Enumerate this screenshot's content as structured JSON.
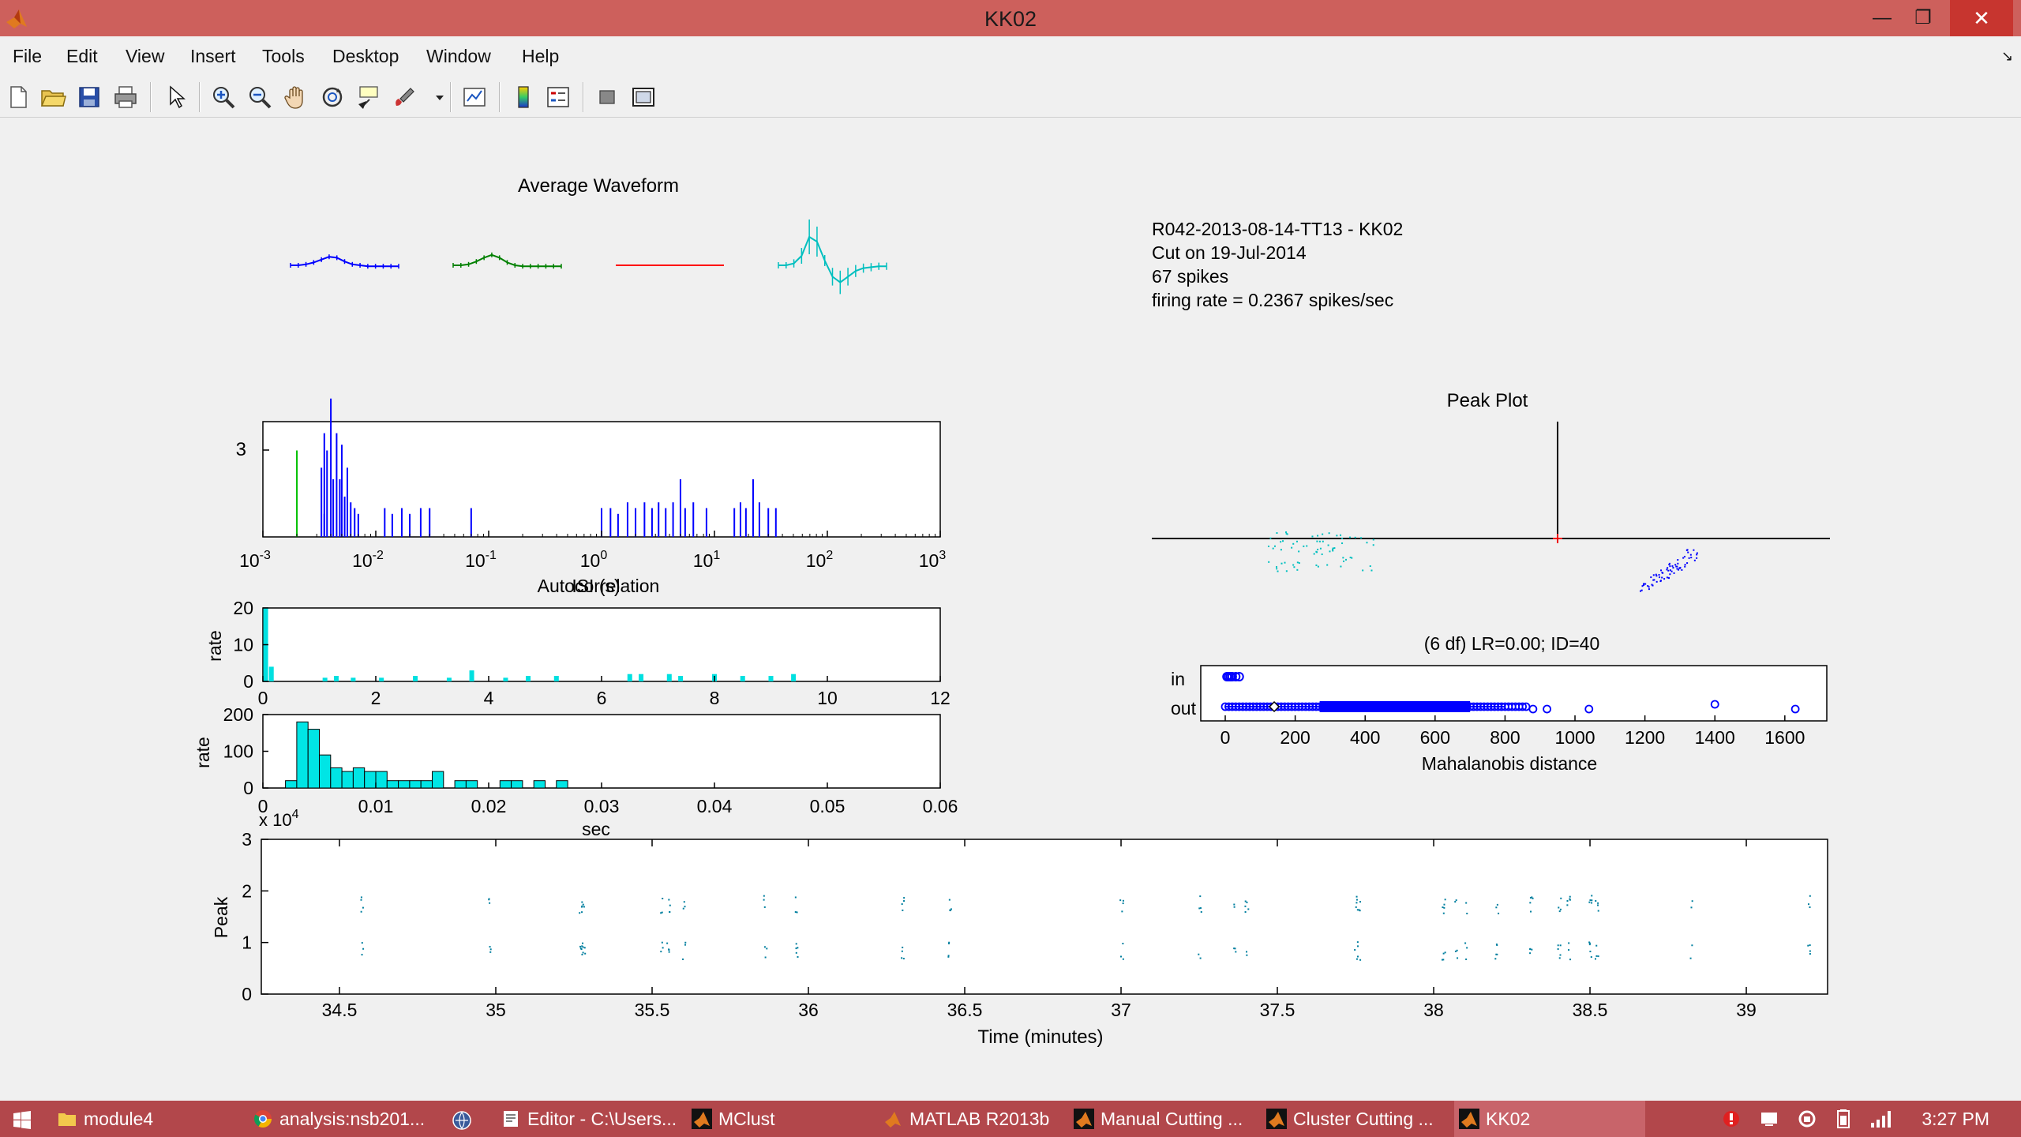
{
  "window": {
    "title": "KK02"
  },
  "menu": [
    "File",
    "Edit",
    "View",
    "Insert",
    "Tools",
    "Desktop",
    "Window",
    "Help"
  ],
  "toolbar_icons": [
    "new-figure-icon",
    "open-file-icon",
    "save-icon",
    "print-icon",
    "pointer-icon",
    "zoom-in-icon",
    "zoom-out-icon",
    "pan-icon",
    "rotate-3d-icon",
    "data-cursor-icon",
    "brush-icon",
    "dropdown-arrow-icon",
    "link-plot-icon",
    "colorbar-icon",
    "legend-icon",
    "hide-plot-tools-icon",
    "show-plot-tools-icon"
  ],
  "waveform": {
    "title": "Average Waveform",
    "colors": [
      "#0000ff",
      "#008000",
      "#ff0000",
      "#00bfbf"
    ]
  },
  "info": {
    "line1": "R042-2013-08-14-TT13 - KK02",
    "line2": "Cut on 19-Jul-2014",
    "line3": "67 spikes",
    "line4": "firing rate = 0.2367 spikes/sec"
  },
  "isi_hist": {
    "type": "bar",
    "xscale": "log",
    "xlim": [
      0.001,
      1000
    ],
    "xticks": [
      "10",
      "10",
      "10",
      "10",
      "10",
      "10",
      "10"
    ],
    "xtick_exp": [
      "-3",
      "-2",
      "-1",
      "0",
      "1",
      "2",
      "3"
    ],
    "ytick": "3",
    "xlabel": "ISI (s)",
    "marker_line_x": 0.002,
    "marker_color": "#00c000",
    "bar_color": "#0000ff",
    "values": [
      {
        "x": 0.0033,
        "h": 0.6
      },
      {
        "x": 0.0035,
        "h": 0.9
      },
      {
        "x": 0.0037,
        "h": 0.75
      },
      {
        "x": 0.004,
        "h": 1.2
      },
      {
        "x": 0.0042,
        "h": 0.5
      },
      {
        "x": 0.0045,
        "h": 0.9
      },
      {
        "x": 0.0048,
        "h": 0.5
      },
      {
        "x": 0.005,
        "h": 0.8
      },
      {
        "x": 0.0053,
        "h": 0.35
      },
      {
        "x": 0.0056,
        "h": 0.6
      },
      {
        "x": 0.006,
        "h": 0.3
      },
      {
        "x": 0.0065,
        "h": 0.25
      },
      {
        "x": 0.007,
        "h": 0.2
      },
      {
        "x": 0.012,
        "h": 0.25
      },
      {
        "x": 0.014,
        "h": 0.2
      },
      {
        "x": 0.017,
        "h": 0.25
      },
      {
        "x": 0.02,
        "h": 0.2
      },
      {
        "x": 0.025,
        "h": 0.25
      },
      {
        "x": 0.03,
        "h": 0.25
      },
      {
        "x": 0.0035,
        "h": 0.2
      },
      {
        "x": 0.07,
        "h": 0.25
      },
      {
        "x": 1.0,
        "h": 0.25
      },
      {
        "x": 1.2,
        "h": 0.25
      },
      {
        "x": 1.4,
        "h": 0.2
      },
      {
        "x": 1.7,
        "h": 0.3
      },
      {
        "x": 2.0,
        "h": 0.25
      },
      {
        "x": 2.4,
        "h": 0.3
      },
      {
        "x": 2.8,
        "h": 0.25
      },
      {
        "x": 3.2,
        "h": 0.3
      },
      {
        "x": 3.7,
        "h": 0.25
      },
      {
        "x": 4.3,
        "h": 0.3
      },
      {
        "x": 5.0,
        "h": 0.5
      },
      {
        "x": 5.5,
        "h": 0.25
      },
      {
        "x": 6.5,
        "h": 0.3
      },
      {
        "x": 8.5,
        "h": 0.25
      },
      {
        "x": 15,
        "h": 0.25
      },
      {
        "x": 17,
        "h": 0.3
      },
      {
        "x": 19,
        "h": 0.25
      },
      {
        "x": 22,
        "h": 0.5
      },
      {
        "x": 25,
        "h": 0.3
      },
      {
        "x": 30,
        "h": 0.25
      },
      {
        "x": 35,
        "h": 0.25
      }
    ]
  },
  "autocorr": {
    "type": "bar",
    "title": "Autocorrelation",
    "ylabel": "rate",
    "xlim": [
      0,
      12
    ],
    "ylim": [
      0,
      20
    ],
    "xticks": [
      "0",
      "2",
      "4",
      "6",
      "8",
      "10",
      "12"
    ],
    "yticks": [
      "0",
      "10",
      "20"
    ],
    "bar_color": "#00e0e0",
    "bins": [
      {
        "x": 0.05,
        "v": 20
      },
      {
        "x": 0.15,
        "v": 4
      },
      {
        "x": 1.1,
        "v": 1
      },
      {
        "x": 1.3,
        "v": 1.5
      },
      {
        "x": 1.6,
        "v": 1
      },
      {
        "x": 2.1,
        "v": 1
      },
      {
        "x": 2.7,
        "v": 1.5
      },
      {
        "x": 3.3,
        "v": 1
      },
      {
        "x": 3.7,
        "v": 3
      },
      {
        "x": 4.3,
        "v": 1
      },
      {
        "x": 4.7,
        "v": 1.5
      },
      {
        "x": 5.2,
        "v": 1.5
      },
      {
        "x": 6.5,
        "v": 2
      },
      {
        "x": 6.7,
        "v": 2
      },
      {
        "x": 7.2,
        "v": 2
      },
      {
        "x": 7.4,
        "v": 1.5
      },
      {
        "x": 8.0,
        "v": 2
      },
      {
        "x": 8.5,
        "v": 1.5
      },
      {
        "x": 9.0,
        "v": 1.5
      },
      {
        "x": 9.4,
        "v": 2
      }
    ]
  },
  "isi_lin": {
    "type": "bar",
    "ylabel": "rate",
    "xlabel": "sec",
    "xlim": [
      0,
      0.06
    ],
    "ylim": [
      0,
      200
    ],
    "xticks": [
      "0",
      "0.01",
      "0.02",
      "0.03",
      "0.04",
      "0.05",
      "0.06"
    ],
    "yticks": [
      "0",
      "100",
      "200"
    ],
    "bar_color": "#00e5e5",
    "bin_width": 0.001,
    "bins": [
      {
        "x": 0.002,
        "v": 20
      },
      {
        "x": 0.003,
        "v": 180
      },
      {
        "x": 0.004,
        "v": 160
      },
      {
        "x": 0.005,
        "v": 90
      },
      {
        "x": 0.006,
        "v": 55
      },
      {
        "x": 0.007,
        "v": 45
      },
      {
        "x": 0.008,
        "v": 55
      },
      {
        "x": 0.009,
        "v": 45
      },
      {
        "x": 0.01,
        "v": 45
      },
      {
        "x": 0.011,
        "v": 20
      },
      {
        "x": 0.012,
        "v": 20
      },
      {
        "x": 0.013,
        "v": 20
      },
      {
        "x": 0.014,
        "v": 20
      },
      {
        "x": 0.015,
        "v": 45
      },
      {
        "x": 0.017,
        "v": 20
      },
      {
        "x": 0.018,
        "v": 20
      },
      {
        "x": 0.021,
        "v": 20
      },
      {
        "x": 0.022,
        "v": 20
      },
      {
        "x": 0.024,
        "v": 20
      },
      {
        "x": 0.026,
        "v": 20
      }
    ]
  },
  "peak_plot": {
    "title": "Peak Plot",
    "clusters": [
      {
        "name": "cyan",
        "color": "#00c0c0"
      },
      {
        "name": "blue",
        "color": "#0000ff"
      }
    ]
  },
  "mahal": {
    "title": "(6 df) LR=0.00; ID=40",
    "xlabel": "Mahalanobis distance",
    "ylabels": [
      "in",
      "out"
    ],
    "xlim": [
      -70,
      1720
    ],
    "xticks": [
      "0",
      "200",
      "400",
      "600",
      "800",
      "1000",
      "1200",
      "1400",
      "1600"
    ],
    "marker_color": "#0000ff"
  },
  "peak_time": {
    "type": "scatter",
    "ylabel": "Peak",
    "xlabel": "Time (minutes)",
    "exponent": "x 10",
    "exponent_sup": "4",
    "xlim": [
      34.25,
      39.26
    ],
    "ylim": [
      0,
      3
    ],
    "xticks": [
      "34.5",
      "35",
      "35.5",
      "36",
      "36.5",
      "37",
      "37.5",
      "38",
      "38.5",
      "39"
    ],
    "yticks": [
      "0",
      "1",
      "2",
      "3"
    ],
    "point_color": "#007f9f",
    "spike_times": [
      34.57,
      34.98,
      35.27,
      35.28,
      35.53,
      35.55,
      35.6,
      35.86,
      35.96,
      36.3,
      36.45,
      37.0,
      37.25,
      37.36,
      37.4,
      37.75,
      37.76,
      38.03,
      38.07,
      38.1,
      38.2,
      38.31,
      38.4,
      38.43,
      38.5,
      38.52,
      38.82,
      39.2
    ]
  },
  "taskbar": {
    "items": [
      "module4",
      "analysis:nsb201...",
      "",
      "Editor - C:\\Users...",
      "MClust",
      "MATLAB R2013b",
      "Manual Cutting ...",
      "Cluster Cutting ...",
      "KK02"
    ],
    "active": "KK02",
    "clock": "3:27 PM"
  }
}
